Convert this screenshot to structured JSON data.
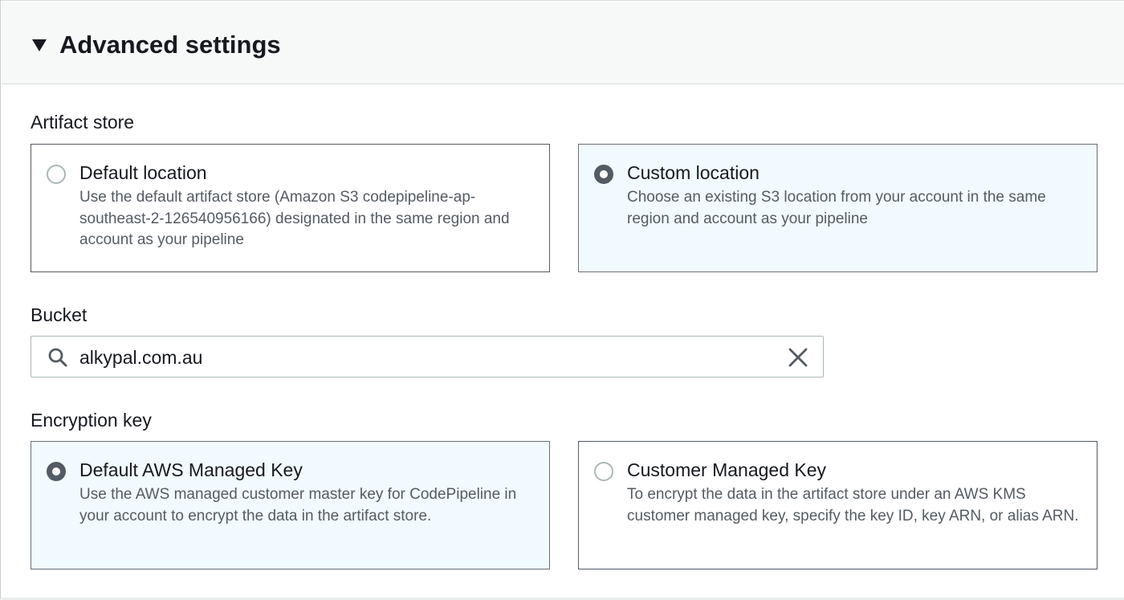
{
  "section": {
    "title": "Advanced settings",
    "expanded": true
  },
  "artifact_store": {
    "label": "Artifact store",
    "selected": "custom",
    "options": [
      {
        "id": "default",
        "title": "Default location",
        "description": "Use the default artifact store (Amazon S3 codepipeline-ap-southeast-2-126540956166) designated in the same region and account as your pipeline"
      },
      {
        "id": "custom",
        "title": "Custom location",
        "description": "Choose an existing S3 location from your account in the same region and account as your pipeline"
      }
    ]
  },
  "bucket": {
    "label": "Bucket",
    "value": "alkypal.com.au",
    "search_icon": "search-icon",
    "clear_icon": "close-icon"
  },
  "encryption_key": {
    "label": "Encryption key",
    "selected": "default",
    "options": [
      {
        "id": "default",
        "title": "Default AWS Managed Key",
        "description": "Use the AWS managed customer master key for CodePipeline in your account to encrypt the data in the artifact store."
      },
      {
        "id": "customer",
        "title": "Customer Managed Key",
        "description": "To encrypt the data in the artifact store under an AWS KMS customer managed key, specify the key ID, key ARN, or alias ARN."
      }
    ]
  },
  "colors": {
    "selected_tile_bg": "#f1faff",
    "radio_selected": "#545b64",
    "radio_unselected_border": "#aab7b8",
    "text_primary": "#16191f",
    "text_secondary": "#545b64",
    "header_bg": "#f7f8f8"
  }
}
